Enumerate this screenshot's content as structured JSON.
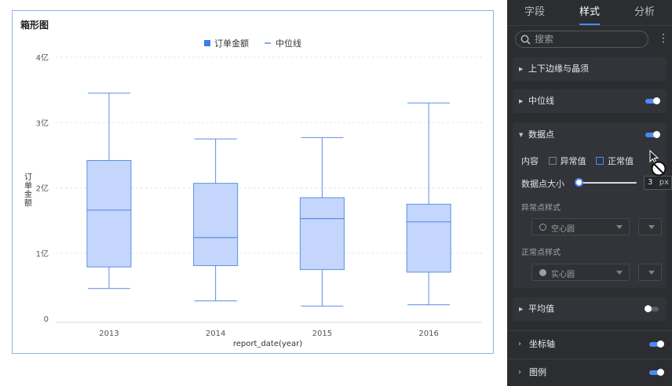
{
  "chart": {
    "title": "箱形图",
    "legend": [
      {
        "label": "订单金额",
        "marker": "square",
        "color": "#3d7ee8"
      },
      {
        "label": "中位线",
        "marker": "line",
        "color": "#5b8fe6"
      }
    ],
    "y_axis_label": "订单金额",
    "x_axis_label": "report_date(year)"
  },
  "chart_data": {
    "type": "box",
    "title": "箱形图",
    "xlabel": "report_date(year)",
    "ylabel": "订单金额",
    "categories": [
      "2013",
      "2014",
      "2015",
      "2016"
    ],
    "y_ticks": [
      "0",
      "1亿",
      "2亿",
      "3亿",
      "4亿"
    ],
    "ylim": [
      0,
      4
    ],
    "y_unit": "亿",
    "series": [
      {
        "name": "订单金额",
        "boxes": [
          {
            "min": 0.46,
            "q1": 0.79,
            "median": 1.66,
            "q3": 2.42,
            "max": 3.45
          },
          {
            "min": 0.27,
            "q1": 0.81,
            "median": 1.24,
            "q3": 2.07,
            "max": 2.75
          },
          {
            "min": 0.19,
            "q1": 0.75,
            "median": 1.53,
            "q3": 1.85,
            "max": 2.77
          },
          {
            "min": 0.21,
            "q1": 0.71,
            "median": 1.48,
            "q3": 1.75,
            "max": 3.3
          }
        ]
      }
    ],
    "grid": true,
    "legend_position": "top-center",
    "box_fill": "#c4d6fb",
    "box_stroke": "#5b8fe6"
  },
  "panel": {
    "tabs": [
      "字段",
      "样式",
      "分析"
    ],
    "active_tab": 1,
    "search": {
      "placeholder": "搜索",
      "value": ""
    },
    "more_icon": "⋮",
    "sections": {
      "whisker": {
        "label": "上下边缘与晶须"
      },
      "median_line": {
        "label": "中位线",
        "enabled": true
      },
      "data_point": {
        "label": "数据点",
        "enabled": true,
        "content_label": "内容",
        "abnormal_label": "异常值",
        "normal_label": "正常值",
        "size_label": "数据点大小",
        "size_value": "3",
        "size_unit": "px",
        "size_fraction": 0.0,
        "abnormal_style_label": "异常点样式",
        "abnormal_style_value": "空心圆",
        "normal_style_label": "正常点样式",
        "normal_style_value": "实心圆"
      },
      "average": {
        "label": "平均值",
        "enabled": false
      },
      "axis": {
        "label": "坐标轴",
        "enabled": true
      },
      "legend": {
        "label": "图例",
        "enabled": true
      }
    }
  }
}
